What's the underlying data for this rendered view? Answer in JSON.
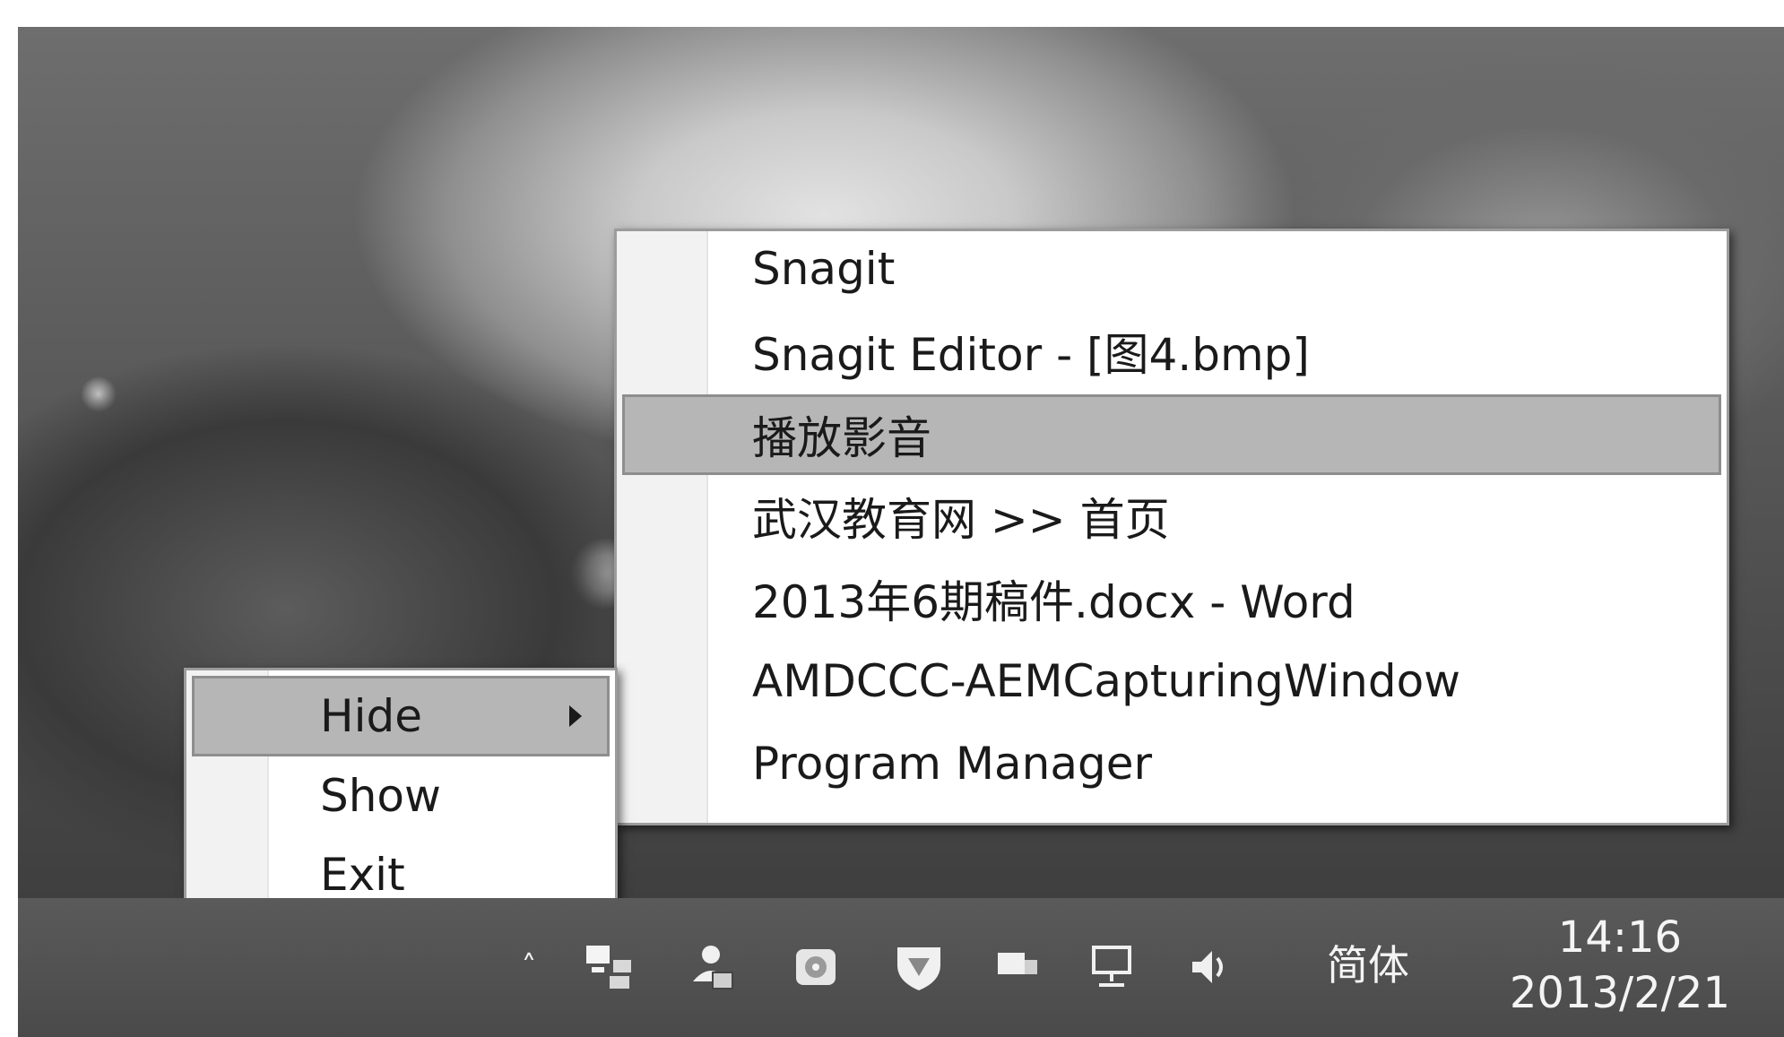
{
  "tray_menu": {
    "items": [
      {
        "label": "Hide",
        "highlighted": true,
        "has_submenu": true
      },
      {
        "label": "Show",
        "highlighted": false,
        "has_submenu": false
      },
      {
        "label": "Exit",
        "highlighted": false,
        "has_submenu": false
      }
    ]
  },
  "window_submenu": {
    "items": [
      {
        "label": "Snagit",
        "highlighted": false
      },
      {
        "label": "Snagit Editor - [图4.bmp]",
        "highlighted": false
      },
      {
        "label": "播放影音",
        "highlighted": true
      },
      {
        "label": "武汉教育网 >> 首页",
        "highlighted": false
      },
      {
        "label": "2013年6期稿件.docx - Word",
        "highlighted": false
      },
      {
        "label": "AMDCCC-AEMCapturingWindow",
        "highlighted": false
      },
      {
        "label": "Program Manager",
        "highlighted": false
      }
    ]
  },
  "taskbar": {
    "overflow_chevron": "˄",
    "tray_icons": [
      {
        "name": "overflow-chevron-icon"
      },
      {
        "name": "window-hider-icon"
      },
      {
        "name": "user-lock-icon"
      },
      {
        "name": "disk-icon"
      },
      {
        "name": "shield-icon"
      },
      {
        "name": "flag-icon"
      },
      {
        "name": "network-icon"
      },
      {
        "name": "volume-icon"
      }
    ],
    "ime_label": "简体",
    "clock": {
      "time": "14:16",
      "date": "2013/2/21"
    }
  }
}
